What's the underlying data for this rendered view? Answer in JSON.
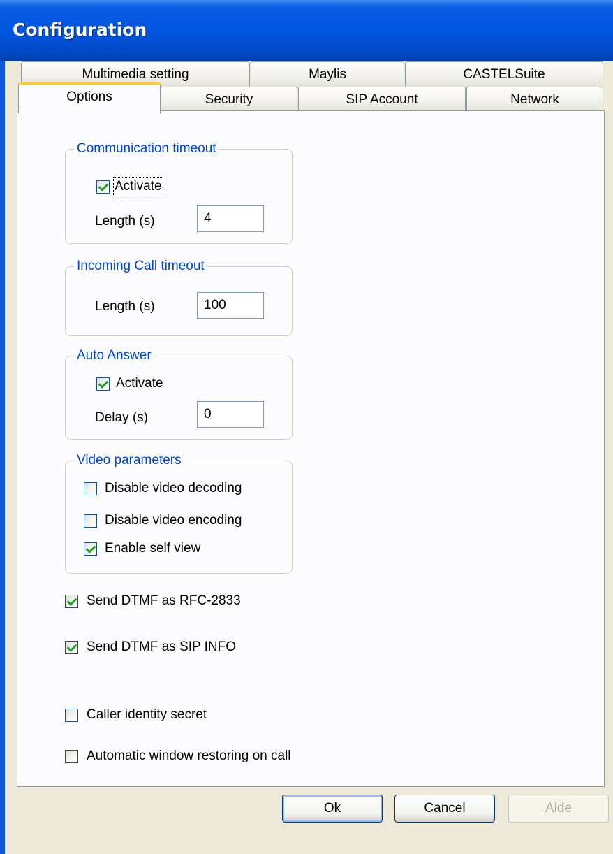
{
  "window": {
    "title": "Configuration"
  },
  "tabs_top": [
    {
      "label": "Multimedia setting"
    },
    {
      "label": "Maylis"
    },
    {
      "label": "CASTELSuite"
    }
  ],
  "tabs_bottom": [
    {
      "label": "Options",
      "selected": true
    },
    {
      "label": "Security"
    },
    {
      "label": "SIP Account"
    },
    {
      "label": "Network"
    }
  ],
  "communication_timeout": {
    "legend": "Communication timeout",
    "activate_label": "Activate",
    "activate_checked": true,
    "length_label": "Length (s)",
    "length_value": "4"
  },
  "incoming_call_timeout": {
    "legend": "Incoming Call timeout",
    "length_label": "Length (s)",
    "length_value": "100"
  },
  "auto_answer": {
    "legend": "Auto Answer",
    "activate_label": "Activate",
    "activate_checked": true,
    "delay_label": "Delay (s)",
    "delay_value": "0"
  },
  "video_parameters": {
    "legend": "Video parameters",
    "disable_decoding_label": "Disable video decoding",
    "disable_decoding_checked": false,
    "disable_encoding_label": "Disable video encoding",
    "disable_encoding_checked": false,
    "self_view_label": "Enable self view",
    "self_view_checked": true
  },
  "options": {
    "dtmf_rfc_label": "Send DTMF as RFC-2833",
    "dtmf_rfc_checked": true,
    "dtmf_sip_label": "Send DTMF as SIP INFO",
    "dtmf_sip_checked": true,
    "caller_secret_label": "Caller identity secret",
    "caller_secret_checked": false,
    "auto_restore_label": "Automatic window restoring on call",
    "auto_restore_checked": false
  },
  "buttons": {
    "ok": "Ok",
    "cancel": "Cancel",
    "help": "Aide",
    "help_enabled": false
  },
  "colors": {
    "titlebar": "#0056e0",
    "group_legend": "#0046d5",
    "selected_tab_accent": "#ffc83c",
    "check_mark": "#21a121",
    "dialog_bg": "#ece9d8"
  }
}
